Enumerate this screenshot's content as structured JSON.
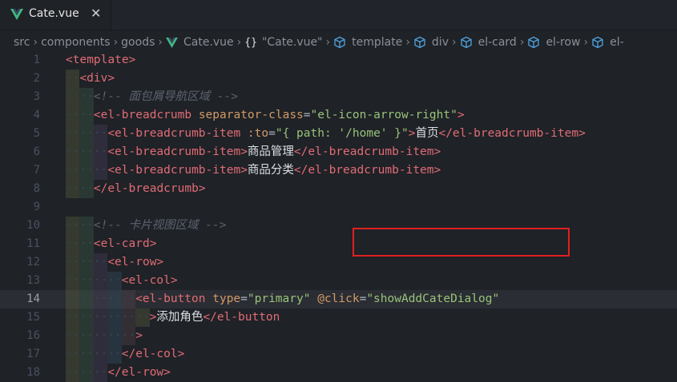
{
  "tab": {
    "title": "Cate.vue",
    "close": "✕"
  },
  "breadcrumbs": [
    "src",
    "components",
    "goods",
    "Cate.vue",
    "\"Cate.vue\"",
    "template",
    "div",
    "el-card",
    "el-row",
    "el-"
  ],
  "breadcrumb_brace": "{}",
  "colors": {
    "tag": "#e06c75",
    "attr": "#d19a66",
    "string": "#98c379",
    "comment": "#5c6370",
    "highlight_box": "#e02020",
    "vue_green": "#41b883"
  },
  "lines": [
    {
      "n": "1",
      "code": "<template>"
    },
    {
      "n": "2",
      "code": "  <div>"
    },
    {
      "n": "3",
      "code": "    <!-- 面包屑导航区域 -->"
    },
    {
      "n": "4",
      "code": "    <el-breadcrumb separator-class=\"el-icon-arrow-right\">"
    },
    {
      "n": "5",
      "code": "      <el-breadcrumb-item :to=\"{ path: '/home' }\">首页</el-breadcrumb-item>"
    },
    {
      "n": "6",
      "code": "      <el-breadcrumb-item>商品管理</el-breadcrumb-item>"
    },
    {
      "n": "7",
      "code": "      <el-breadcrumb-item>商品分类</el-breadcrumb-item>"
    },
    {
      "n": "8",
      "code": "    </el-breadcrumb>"
    },
    {
      "n": "9",
      "code": ""
    },
    {
      "n": "10",
      "code": "    <!-- 卡片视图区域 -->"
    },
    {
      "n": "11",
      "code": "    <el-card>"
    },
    {
      "n": "12",
      "code": "      <el-row>"
    },
    {
      "n": "13",
      "code": "        <el-col>"
    },
    {
      "n": "14",
      "code": "          <el-button type=\"primary\" @click=\"showAddCateDialog\""
    },
    {
      "n": "15",
      "code": "            >添加角色</el-button"
    },
    {
      "n": "16",
      "code": "          >"
    },
    {
      "n": "17",
      "code": "        </el-col>"
    },
    {
      "n": "18",
      "code": "      </el-row>"
    }
  ],
  "active_line": "14"
}
